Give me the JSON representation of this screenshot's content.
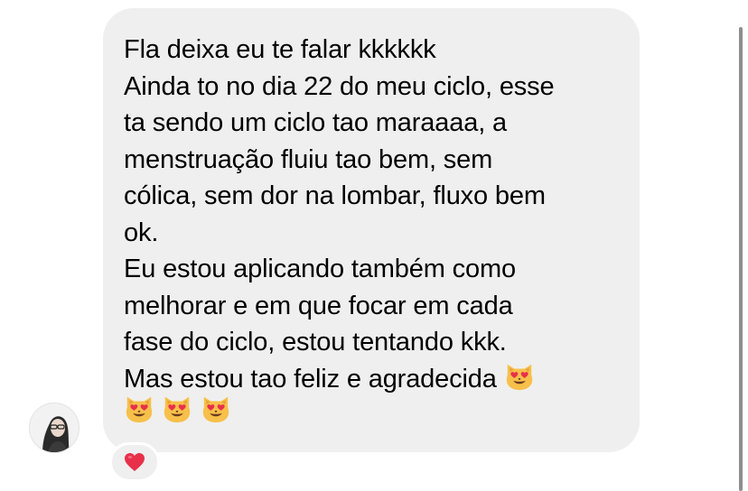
{
  "message": {
    "lines": [
      "Fla deixa eu te falar kkkkkk",
      "Ainda to no dia 22 do meu ciclo, esse",
      "ta sendo um ciclo tao maraaaa, a",
      "menstruação fluiu tao bem, sem",
      "cólica, sem dor na lombar, fluxo bem",
      "ok.",
      "Eu estou aplicando também como",
      "melhorar e em que focar  em cada",
      "fase do ciclo, estou tentando kkk.",
      "Mas estou tao feliz e agradecida"
    ],
    "emojis": {
      "inline": "smiling-cat-heart-eyes-icon",
      "trailing": [
        "smiling-cat-heart-eyes-icon",
        "smiling-cat-heart-eyes-icon",
        "smiling-cat-heart-eyes-icon"
      ]
    }
  },
  "reaction": {
    "icon": "red-heart-icon",
    "color": "#e0245e"
  },
  "colors": {
    "bubble": "#efefef",
    "text": "#000000",
    "cat_face": "#f7c04a",
    "heart": "#e8304a"
  }
}
